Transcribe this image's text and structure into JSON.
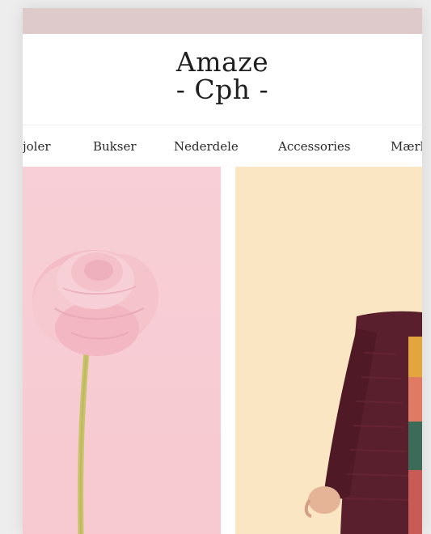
{
  "brand": {
    "line1": "Amaze",
    "line2": "- Cph -"
  },
  "nav": {
    "items": [
      {
        "label": "joler"
      },
      {
        "label": "Bukser"
      },
      {
        "label": "Nederdele"
      },
      {
        "label": "Accessories"
      },
      {
        "label": "Mærk"
      }
    ]
  },
  "colors": {
    "top_bar": "#dfcacb",
    "tile_left_bg": "#f8cfd6",
    "tile_right_bg": "#fbe6c4"
  },
  "tiles": [
    {
      "image": "pink-flower-photo"
    },
    {
      "image": "person-in-cardigan-photo"
    }
  ]
}
